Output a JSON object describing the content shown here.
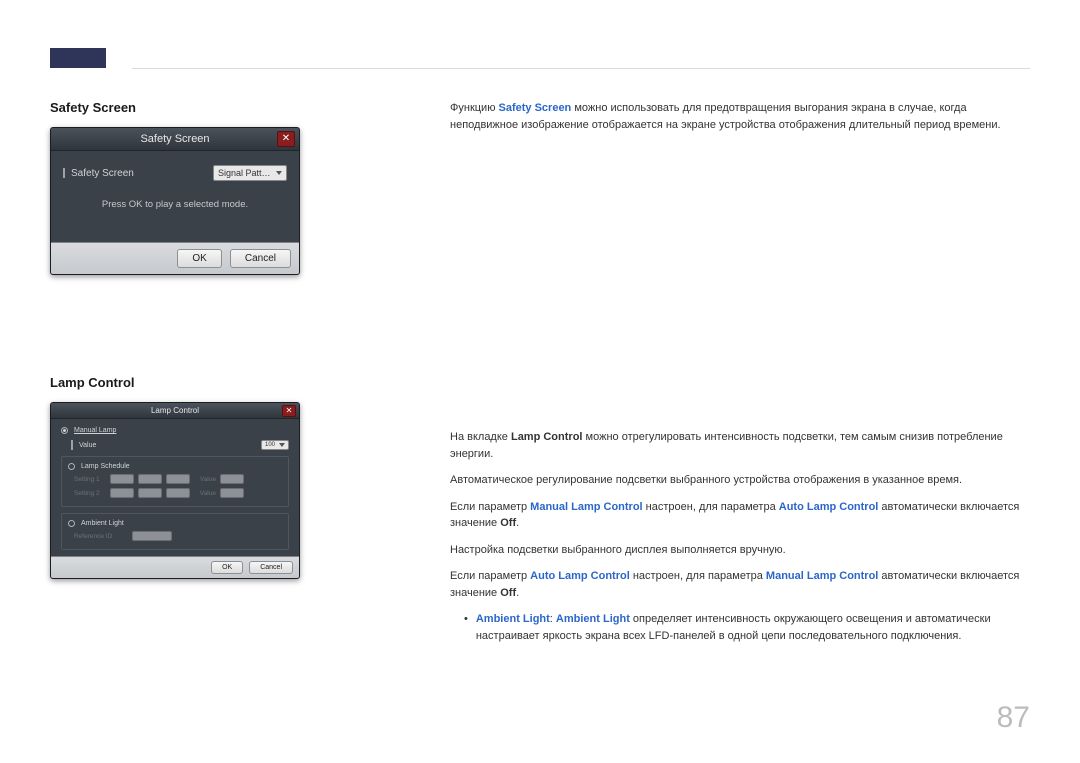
{
  "page_number": "87",
  "sections": {
    "safety": {
      "title": "Safety Screen",
      "dialog": {
        "title": "Safety Screen",
        "close": "✕",
        "field_label": "Safety Screen",
        "field_value": "Signal Patt…",
        "hint": "Press OK to play a selected mode.",
        "ok": "OK",
        "cancel": "Cancel"
      },
      "body_1a": "Функцию ",
      "body_1b": "Safety Screen",
      "body_1c": " можно использовать для предотвращения выгорания экрана в случае, когда неподвижное изображение отображается на экране устройства отображения длительный период времени."
    },
    "lamp": {
      "title": "Lamp Control",
      "dialog": {
        "title": "Lamp Control",
        "close": "✕",
        "manual_lamp": "Manual Lamp",
        "value_label": "Value",
        "value": "100",
        "lamp_schedule": "Lamp Schedule",
        "setting1": "Setting 1",
        "setting2": "Setting 2",
        "value_lbl": "Value",
        "ambient_light": "Ambient Light",
        "reference_id": "Reference ID",
        "ok": "OK",
        "cancel": "Cancel"
      },
      "p1a": "На вкладке ",
      "p1b": "Lamp Control",
      "p1c": " можно отрегулировать интенсивность подсветки, тем самым снизив потребление энергии.",
      "p2": "Автоматическое регулирование подсветки выбранного устройства отображения в указанное время.",
      "p3a": "Если параметр ",
      "p3b": "Manual Lamp Control",
      "p3c": " настроен, для параметра ",
      "p3d": "Auto Lamp Control",
      "p3e": " автоматически включается значение ",
      "p3f": "Off",
      "p3g": ".",
      "p4": "Настройка подсветки выбранного дисплея выполняется вручную.",
      "p5a": "Если параметр ",
      "p5b": "Auto Lamp Control",
      "p5c": " настроен, для параметра ",
      "p5d": "Manual Lamp Control",
      "p5e": " автоматически включается значение ",
      "p5f": "Off",
      "p5g": ".",
      "bullet_a": "Ambient Light",
      "bullet_b": ": ",
      "bullet_c": "Ambient Light",
      "bullet_d": " определяет интенсивность окружающего освещения и автоматически настраивает яркость экрана всех LFD-панелей в одной цепи последовательного подключения."
    }
  }
}
